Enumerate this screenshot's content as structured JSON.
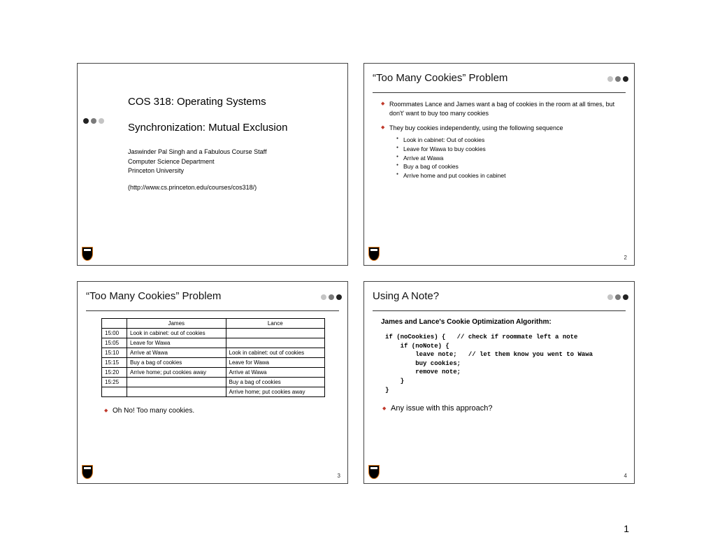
{
  "doc_page": "1",
  "slide1": {
    "course": "COS 318: Operating Systems",
    "subtitle": "Synchronization: Mutual Exclusion",
    "line1": "Jaswinder Pal Singh and a Fabulous Course Staff",
    "line2": "Computer Science Department",
    "line3": "Princeton University",
    "url": "(http://www.cs.princeton.edu/courses/cos318/)"
  },
  "slide2": {
    "title": "“Too Many Cookies” Problem",
    "b1": "Roommates Lance and James want a bag of cookies in the room at all times, but don't' want to buy too many cookies",
    "b2": "They buy cookies independently, using the following sequence",
    "sub": {
      "s1": "Look in cabinet: Out of cookies",
      "s2": "Leave for Wawa to buy cookies",
      "s3": "Arrive at Wawa",
      "s4": "Buy a bag of cookies",
      "s5": "Arrive home and put cookies in cabinet"
    },
    "page": "2"
  },
  "slide3": {
    "title": "“Too Many Cookies” Problem",
    "headers": {
      "h1": "James",
      "h2": "Lance"
    },
    "rows": {
      "t0": "15:00",
      "j0": "Look in cabinet: out of cookies",
      "l0": "",
      "t1": "15:05",
      "j1": "Leave for Wawa",
      "l1": "",
      "t2": "15:10",
      "j2": "Arrive at Wawa",
      "l2": "Look in cabinet: out of cookies",
      "t3": "15:15",
      "j3": "Buy a bag of cookies",
      "l3": "Leave for Wawa",
      "t4": "15:20",
      "j4": "Arrive home; put cookies away",
      "l4": "Arrive at Wawa",
      "t5": "15:25",
      "j5": "",
      "l5": "Buy a bag of cookies",
      "t6": "",
      "j6": "",
      "l6": "Arrive home; put cookies away"
    },
    "note": "Oh No! Too many cookies.",
    "page": "3"
  },
  "slide4": {
    "title": "Using A Note?",
    "heading": "James and Lance's Cookie Optimization Algorithm:",
    "code": "if (noCookies) {   // check if roommate left a note\n    if (noNote) {\n        leave note;   // let them know you went to Wawa\n        buy cookies;\n        remove note;\n    }\n}",
    "issue": "Any issue with this approach?",
    "page": "4"
  }
}
